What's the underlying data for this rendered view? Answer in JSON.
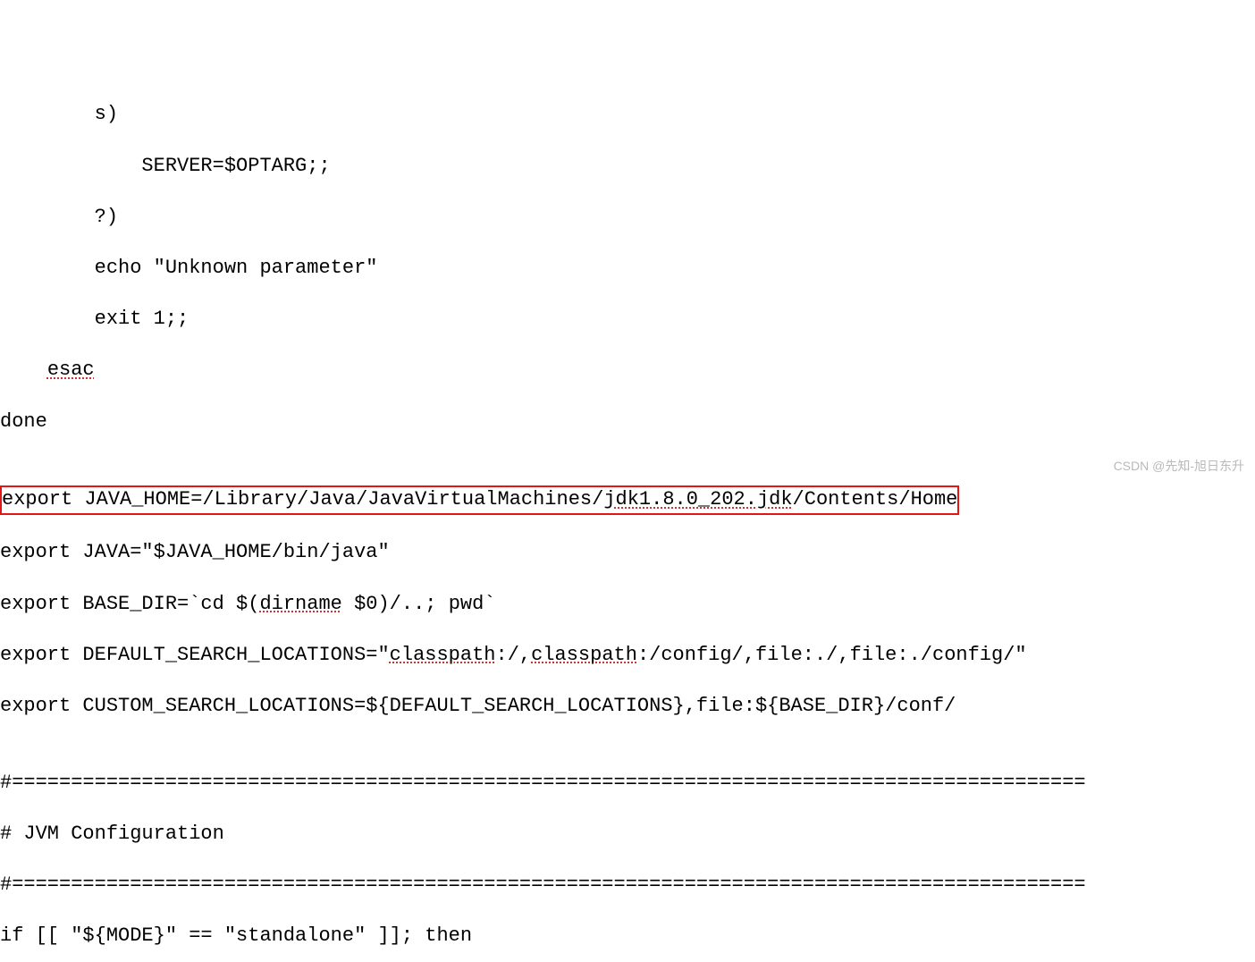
{
  "lines": {
    "l1": "        s)",
    "l2": "            SERVER=$OPTARG;;",
    "l3": "        ?)",
    "l4": "        echo \"Unknown parameter\"",
    "l5": "        exit 1;;",
    "l6_prefix": "    ",
    "l6_word": "esac",
    "l7": "done",
    "l8": "",
    "l9": "export JAVA_HOME=/Library/Java/JavaVirtualMachines/",
    "l9_part2": "jdk1.8.0_202.jdk",
    "l9_part3": "/Contents/Home",
    "l10": "export JAVA=\"$JAVA_HOME/bin/java\"",
    "l11_prefix": "export BASE_DIR=`cd $(",
    "l11_word": "dirname",
    "l11_suffix": " $0)/..; pwd`",
    "l12_prefix": "export DEFAULT_SEARCH_LOCATIONS=\"",
    "l12_word1": "classpath",
    "l12_mid": ":/,",
    "l12_word2": "classpath",
    "l12_suffix": ":/config/,file:./,file:./config/\"",
    "l13": "export CUSTOM_SEARCH_LOCATIONS=${DEFAULT_SEARCH_LOCATIONS},file:${BASE_DIR}/conf/",
    "l14": "",
    "l15": "#===========================================================================================",
    "l16": "# JVM Configuration",
    "l17": "#===========================================================================================",
    "l18": "if [[ \"${MODE}\" == \"standalone\" ]]; then"
  },
  "watermark": "CSDN @先知-旭日东升"
}
